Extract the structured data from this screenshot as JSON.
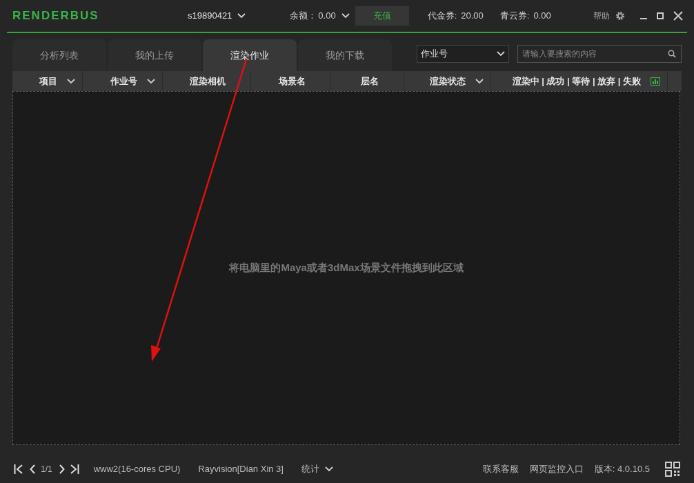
{
  "window": {
    "logo_text": "RENDERBUS",
    "account": "s19890421",
    "balance_label": "余额：",
    "balance": "0.00",
    "recharge_button": "充值",
    "voucher_label": "代金券:",
    "voucher": "20.00",
    "qingyun_label": "青云券:",
    "qingyun": "0.00",
    "help": "帮助"
  },
  "tabs": [
    {
      "label": "分析列表",
      "selected": false
    },
    {
      "label": "我的上传",
      "selected": false
    },
    {
      "label": "渲染作业",
      "selected": true
    },
    {
      "label": "我的下载",
      "selected": false
    }
  ],
  "search": {
    "filter": "作业号",
    "placeholder": "请输入要搜索的内容"
  },
  "table": {
    "columns": [
      {
        "label": "项目",
        "dropdown": true
      },
      {
        "label": "作业号",
        "dropdown": true
      },
      {
        "label": "渲染相机",
        "dropdown": false
      },
      {
        "label": "场景名",
        "dropdown": false
      },
      {
        "label": "层名",
        "dropdown": false
      },
      {
        "label": "渲染状态",
        "dropdown": true
      },
      {
        "label": "渲染中 | 成功 | 等待 | 放弃 | 失败",
        "dropdown": false
      }
    ],
    "empty_message": "将电脑里的Maya或者3dMax场景文件拖拽到此区域"
  },
  "status_bar": {
    "page": "1/1",
    "machine": "www2(16-cores CPU)",
    "server": "Rayvision[Dian Xin 3]",
    "stats": "统计",
    "contact": "联系客服",
    "web_monitor": "网页监控入口",
    "version": "版本: 4.0.10.5"
  }
}
